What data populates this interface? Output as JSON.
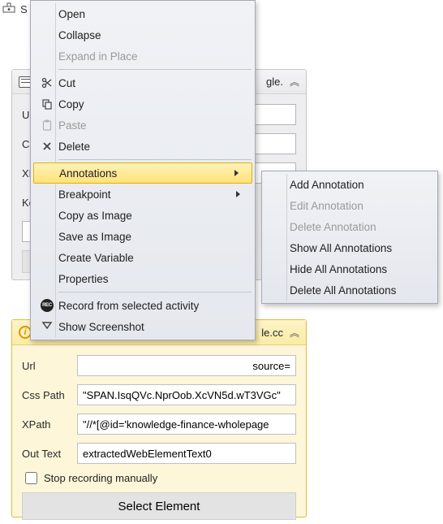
{
  "titlebar": {
    "text": "S"
  },
  "panel_grey": {
    "header_right": "gle.",
    "rows": {
      "url_label": "Url",
      "css_label": "Css",
      "xp_label": "XP",
      "ke_label": "Ke"
    }
  },
  "panel_yellow": {
    "header_right": "le.cc",
    "rows": {
      "url_label": "Url",
      "url_value_suffix": "source=",
      "css_label": "Css Path",
      "css_value": "\"SPAN.IsqQVc.NprOob.XcVN5d.wT3VGc\"",
      "xpath_label": "XPath",
      "xpath_value": "\"//*[@id='knowledge-finance-wholepage",
      "out_label": "Out Text",
      "out_value": "extractedWebElementText0"
    },
    "checkbox_label": "Stop recording manually",
    "select_button": "Select Element"
  },
  "context_menu": {
    "items": [
      {
        "label": "Open",
        "enabled": true
      },
      {
        "label": "Collapse",
        "enabled": true
      },
      {
        "label": "Expand in Place",
        "enabled": false
      },
      {
        "sep": true
      },
      {
        "label": "Cut",
        "enabled": true,
        "icon": "scissors"
      },
      {
        "label": "Copy",
        "enabled": true,
        "icon": "copy"
      },
      {
        "label": "Paste",
        "enabled": false,
        "icon": "paste"
      },
      {
        "label": "Delete",
        "enabled": true,
        "icon": "delete"
      },
      {
        "sep": true
      },
      {
        "label": "Annotations",
        "enabled": true,
        "submenu": true,
        "hover": true
      },
      {
        "label": "Breakpoint",
        "enabled": true,
        "submenu": true
      },
      {
        "label": "Copy as Image",
        "enabled": true
      },
      {
        "label": "Save as Image",
        "enabled": true
      },
      {
        "label": "Create Variable",
        "enabled": true
      },
      {
        "label": "Properties",
        "enabled": true
      },
      {
        "sep": true
      },
      {
        "label": "Record from selected activity",
        "enabled": true,
        "icon": "rec"
      },
      {
        "label": "Show Screenshot",
        "enabled": true,
        "icon": "filter"
      }
    ]
  },
  "submenu": {
    "items": [
      {
        "label": "Add Annotation",
        "enabled": true
      },
      {
        "label": "Edit Annotation",
        "enabled": false
      },
      {
        "label": "Delete Annotation",
        "enabled": false
      },
      {
        "label": "Show All Annotations",
        "enabled": true
      },
      {
        "label": "Hide All Annotations",
        "enabled": true
      },
      {
        "label": "Delete All Annotations",
        "enabled": true
      }
    ]
  }
}
